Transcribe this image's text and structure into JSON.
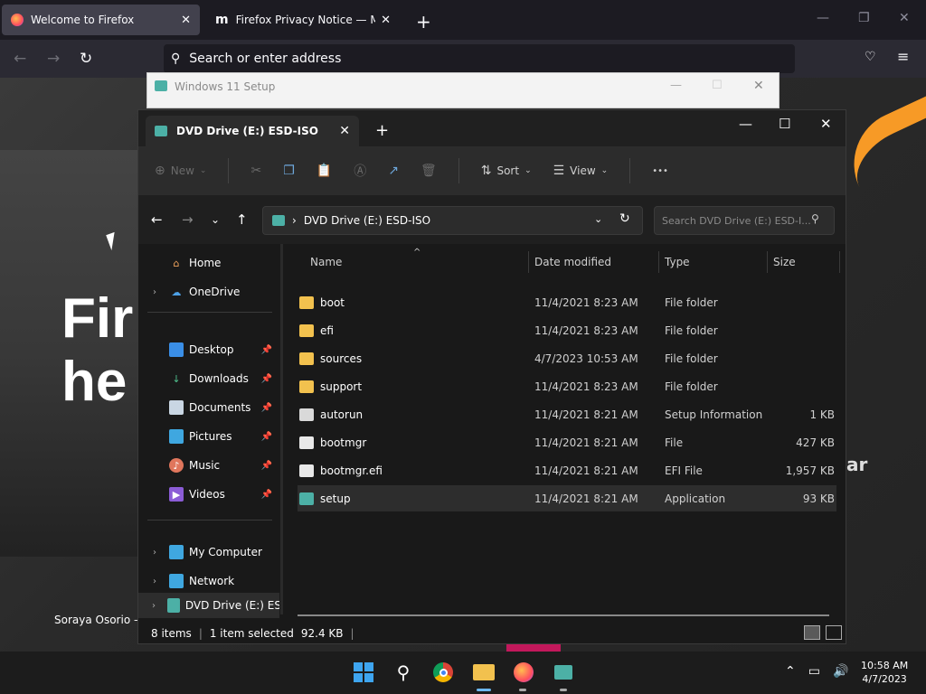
{
  "browser": {
    "tabs": [
      {
        "label": "Welcome to Firefox"
      },
      {
        "label": "Firefox Privacy Notice — Mozilla"
      }
    ],
    "new_tab_icon": "plus-icon",
    "url_placeholder": "Search or enter address",
    "page": {
      "headline_line1": "Fir",
      "headline_line2": "he",
      "author": "Soraya Osorio —",
      "side_text": "ar"
    }
  },
  "setup_window": {
    "title": "Windows 11 Setup"
  },
  "explorer": {
    "tab_title": "DVD Drive (E:) ESD-ISO",
    "toolbar": {
      "new_label": "New",
      "sort_label": "Sort",
      "view_label": "View",
      "more_label": "•••"
    },
    "address": "DVD Drive (E:) ESD-ISO",
    "search_placeholder": "Search DVD Drive (E:) ESD-I...",
    "nav": {
      "home": "Home",
      "onedrive": "OneDrive",
      "desktop": "Desktop",
      "downloads": "Downloads",
      "documents": "Documents",
      "pictures": "Pictures",
      "music": "Music",
      "videos": "Videos",
      "my_computer": "My Computer",
      "network": "Network",
      "dvd": "DVD Drive (E:) ESD-"
    },
    "columns": {
      "name": "Name",
      "date": "Date modified",
      "type": "Type",
      "size": "Size"
    },
    "files": [
      {
        "name": "boot",
        "date": "11/4/2021 8:23 AM",
        "type": "File folder",
        "size": ""
      },
      {
        "name": "efi",
        "date": "11/4/2021 8:23 AM",
        "type": "File folder",
        "size": ""
      },
      {
        "name": "sources",
        "date": "4/7/2023 10:53 AM",
        "type": "File folder",
        "size": ""
      },
      {
        "name": "support",
        "date": "11/4/2021 8:23 AM",
        "type": "File folder",
        "size": ""
      },
      {
        "name": "autorun",
        "date": "11/4/2021 8:21 AM",
        "type": "Setup Information",
        "size": "1 KB"
      },
      {
        "name": "bootmgr",
        "date": "11/4/2021 8:21 AM",
        "type": "File",
        "size": "427 KB"
      },
      {
        "name": "bootmgr.efi",
        "date": "11/4/2021 8:21 AM",
        "type": "EFI File",
        "size": "1,957 KB"
      },
      {
        "name": "setup",
        "date": "11/4/2021 8:21 AM",
        "type": "Application",
        "size": "93 KB"
      }
    ],
    "status": {
      "items": "8 items",
      "selected": "1 item selected",
      "size": "92.4 KB"
    }
  },
  "taskbar": {
    "time": "10:58 AM",
    "date": "4/7/2023"
  },
  "colors": {
    "folder": "#f2c14e",
    "firefox_orange": "#f79a26",
    "explorer_bg": "#191919"
  }
}
